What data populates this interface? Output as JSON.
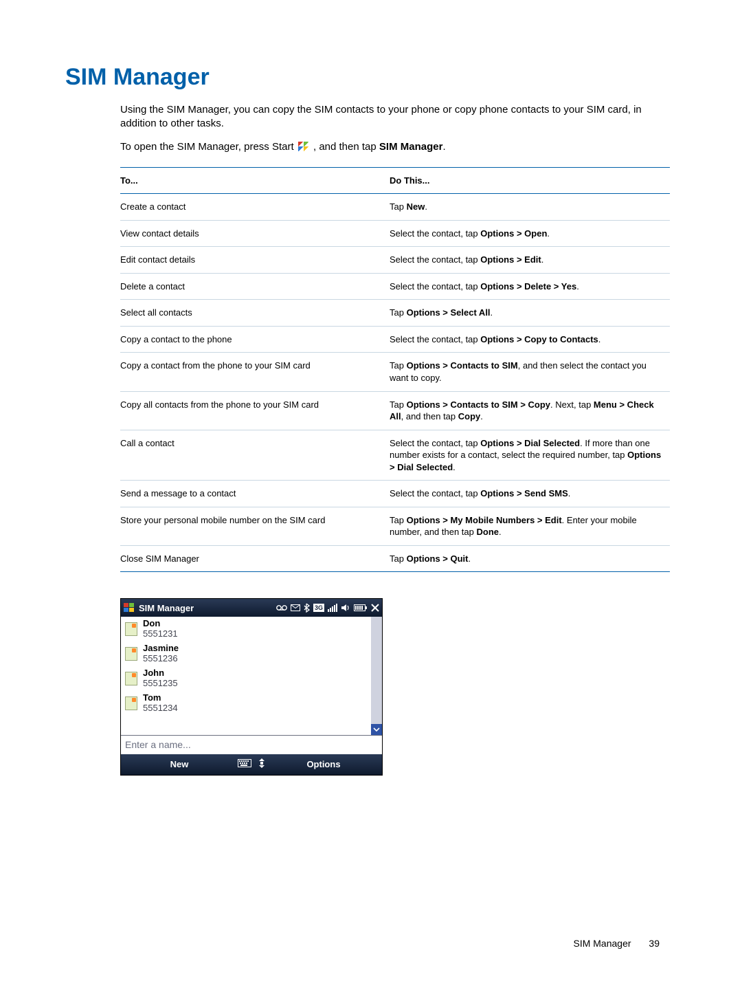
{
  "page": {
    "title": "SIM Manager",
    "intro": "Using the SIM Manager, you can copy the SIM contacts to your phone or copy phone contacts to your SIM card, in addition to other tasks.",
    "open_prefix": "To open the SIM Manager, press Start ",
    "open_mid": ", and then tap ",
    "open_target": "SIM Manager",
    "open_suffix": "."
  },
  "table": {
    "head_to": "To...",
    "head_do": "Do This...",
    "rows": [
      {
        "to": "Create a contact",
        "do": [
          {
            "t": "Tap "
          },
          {
            "b": "New"
          },
          {
            "t": "."
          }
        ]
      },
      {
        "to": "View contact details",
        "do": [
          {
            "t": "Select the contact, tap "
          },
          {
            "b": "Options > Open"
          },
          {
            "t": "."
          }
        ]
      },
      {
        "to": "Edit contact details",
        "do": [
          {
            "t": "Select the contact, tap "
          },
          {
            "b": "Options > Edit"
          },
          {
            "t": "."
          }
        ]
      },
      {
        "to": "Delete a contact",
        "do": [
          {
            "t": "Select the contact, tap "
          },
          {
            "b": "Options > Delete > Yes"
          },
          {
            "t": "."
          }
        ]
      },
      {
        "to": "Select all contacts",
        "do": [
          {
            "t": "Tap "
          },
          {
            "b": "Options > Select All"
          },
          {
            "t": "."
          }
        ]
      },
      {
        "to": "Copy a contact to the phone",
        "do": [
          {
            "t": "Select the contact, tap "
          },
          {
            "b": "Options > Copy to Contacts"
          },
          {
            "t": "."
          }
        ]
      },
      {
        "to": "Copy a contact from the phone to your SIM card",
        "do": [
          {
            "t": "Tap "
          },
          {
            "b": "Options > Contacts to SIM"
          },
          {
            "t": ", and then select the contact you want to copy."
          }
        ]
      },
      {
        "to": "Copy all contacts from the phone to your SIM card",
        "do": [
          {
            "t": "Tap "
          },
          {
            "b": "Options > Contacts to SIM > Copy"
          },
          {
            "t": ". Next, tap "
          },
          {
            "b": "Menu > Check All"
          },
          {
            "t": ", and then tap "
          },
          {
            "b": "Copy"
          },
          {
            "t": "."
          }
        ]
      },
      {
        "to": "Call a contact",
        "do": [
          {
            "t": "Select the contact, tap "
          },
          {
            "b": "Options > Dial Selected"
          },
          {
            "t": ". If more than one number exists for a contact, select the required number, tap "
          },
          {
            "b": "Options > Dial Selected"
          },
          {
            "t": "."
          }
        ]
      },
      {
        "to": "Send a message to a contact",
        "do": [
          {
            "t": "Select the contact, tap "
          },
          {
            "b": "Options > Send SMS"
          },
          {
            "t": "."
          }
        ]
      },
      {
        "to": "Store your personal mobile number on the SIM card",
        "do": [
          {
            "t": "Tap "
          },
          {
            "b": "Options > My Mobile Numbers > Edit"
          },
          {
            "t": ". Enter your mobile number, and then tap "
          },
          {
            "b": "Done"
          },
          {
            "t": "."
          }
        ]
      },
      {
        "to": "Close SIM Manager",
        "do": [
          {
            "t": "Tap "
          },
          {
            "b": "Options > Quit"
          },
          {
            "t": "."
          }
        ]
      }
    ]
  },
  "device": {
    "title": "SIM Manager",
    "status_icons": [
      "voicemail-icon",
      "envelope-icon",
      "bluetooth-icon",
      "3g-icon",
      "signal-icon",
      "volume-icon",
      "battery-icon",
      "close-icon"
    ],
    "contacts": [
      {
        "name": "Don",
        "number": "5551231"
      },
      {
        "name": "Jasmine",
        "number": "5551236"
      },
      {
        "name": "John",
        "number": "5551235"
      },
      {
        "name": "Tom",
        "number": "5551234"
      }
    ],
    "name_input_placeholder": "Enter a name...",
    "softkey_left": "New",
    "softkey_right": "Options"
  },
  "footer": {
    "section": "SIM Manager",
    "page_number": "39"
  }
}
